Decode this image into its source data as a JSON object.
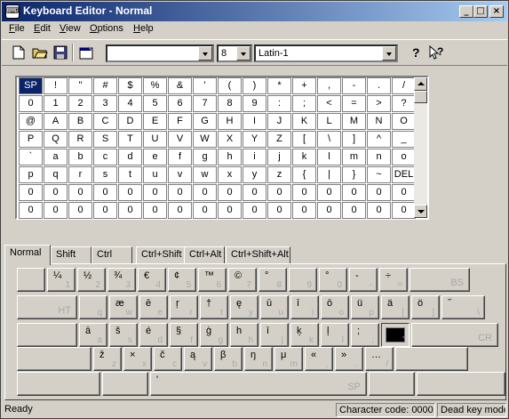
{
  "window": {
    "title": "Keyboard Editor - Normal",
    "icon_glyph": "⌨",
    "controls": {
      "minimize": "_",
      "maximize": "□",
      "close": "×"
    }
  },
  "menu": [
    {
      "label": "File",
      "ul": "F",
      "rest": "ile"
    },
    {
      "label": "Edit",
      "ul": "E",
      "rest": "dit"
    },
    {
      "label": "View",
      "ul": "V",
      "rest": "iew"
    },
    {
      "label": "Options",
      "ul": "O",
      "rest": "ptions"
    },
    {
      "label": "Help",
      "ul": "H",
      "rest": "elp"
    }
  ],
  "toolbar": {
    "icons": [
      "new-document-icon",
      "open-folder-icon",
      "save-disk-icon",
      "properties-icon",
      "help-icon",
      "context-help-icon"
    ],
    "font_name": "",
    "font_size": "8",
    "charset": "Latin-1"
  },
  "char_grid": {
    "selected": "SP",
    "rows": [
      [
        "SP",
        "!",
        "\"",
        "#",
        "$",
        "%",
        "&",
        "'",
        "(",
        ")",
        "*",
        "+",
        ",",
        "-",
        ".",
        "/"
      ],
      [
        "0",
        "1",
        "2",
        "3",
        "4",
        "5",
        "6",
        "7",
        "8",
        "9",
        ":",
        ";",
        "<",
        "=",
        ">",
        "?"
      ],
      [
        "@",
        "A",
        "B",
        "C",
        "D",
        "E",
        "F",
        "G",
        "H",
        "I",
        "J",
        "K",
        "L",
        "M",
        "N",
        "O"
      ],
      [
        "P",
        "Q",
        "R",
        "S",
        "T",
        "U",
        "V",
        "W",
        "X",
        "Y",
        "Z",
        "[",
        "\\",
        "]",
        "^",
        "_"
      ],
      [
        "`",
        "a",
        "b",
        "c",
        "d",
        "e",
        "f",
        "g",
        "h",
        "i",
        "j",
        "k",
        "l",
        "m",
        "n",
        "o"
      ],
      [
        "p",
        "q",
        "r",
        "s",
        "t",
        "u",
        "v",
        "w",
        "x",
        "y",
        "z",
        "{",
        "|",
        "}",
        "~",
        "DEL"
      ],
      [
        "0",
        "0",
        "0",
        "0",
        "0",
        "0",
        "0",
        "0",
        "0",
        "0",
        "0",
        "0",
        "0",
        "0",
        "0",
        "0"
      ],
      [
        "0",
        "0",
        "0",
        "0",
        "0",
        "0",
        "0",
        "0",
        "0",
        "0",
        "0",
        "0",
        "0",
        "0",
        "0",
        "0"
      ]
    ]
  },
  "tabs": [
    "Normal",
    "Shift",
    "Ctrl",
    "Ctrl+Shift",
    "Ctrl+Alt",
    "Ctrl+Shift+Alt"
  ],
  "active_tab": "Normal",
  "keyboard": {
    "row1": [
      {
        "top": "",
        "bot": ""
      },
      {
        "top": "¼",
        "bot": "1"
      },
      {
        "top": "½",
        "bot": "2"
      },
      {
        "top": "¾",
        "bot": "3"
      },
      {
        "top": "€",
        "bot": "4"
      },
      {
        "top": "¢",
        "bot": "5"
      },
      {
        "top": "™",
        "bot": "6"
      },
      {
        "top": "©",
        "bot": "7"
      },
      {
        "top": "°",
        "bot": "8"
      },
      {
        "top": "",
        "bot": "9"
      },
      {
        "top": "°",
        "bot": "0"
      },
      {
        "top": "-",
        "bot": "-"
      },
      {
        "top": "÷",
        "bot": "="
      },
      {
        "top": "",
        "bot": "BS"
      }
    ],
    "row2": [
      {
        "top": "",
        "bot": "HT"
      },
      {
        "top": "",
        "bot": "q"
      },
      {
        "top": "æ",
        "bot": "w"
      },
      {
        "top": "ē",
        "bot": "e"
      },
      {
        "top": "ŗ",
        "bot": "r"
      },
      {
        "top": "†",
        "bot": "t"
      },
      {
        "top": "ę",
        "bot": "y"
      },
      {
        "top": "ū",
        "bot": "u"
      },
      {
        "top": "ī",
        "bot": "i"
      },
      {
        "top": "ō",
        "bot": "o"
      },
      {
        "top": "ü",
        "bot": "p"
      },
      {
        "top": "ä",
        "bot": "["
      },
      {
        "top": "ö",
        "bot": "]"
      },
      {
        "top": "˝",
        "bot": "\\"
      }
    ],
    "row3": [
      {
        "top": "",
        "bot": ""
      },
      {
        "top": "ā",
        "bot": "a"
      },
      {
        "top": "š",
        "bot": "s"
      },
      {
        "top": "é",
        "bot": "d"
      },
      {
        "top": "§",
        "bot": "f"
      },
      {
        "top": "ģ",
        "bot": "g"
      },
      {
        "top": "h",
        "bot": "h"
      },
      {
        "top": "ī",
        "bot": "j"
      },
      {
        "top": "ķ",
        "bot": "k"
      },
      {
        "top": "ļ",
        "bot": "l"
      },
      {
        "top": ";",
        "bot": ";"
      },
      {
        "top": "",
        "bot": "'"
      },
      {
        "top": "",
        "bot": "CR"
      }
    ],
    "row4": [
      {
        "top": "",
        "bot": ""
      },
      {
        "top": "ž",
        "bot": "z"
      },
      {
        "top": "×",
        "bot": "x"
      },
      {
        "top": "č",
        "bot": "c"
      },
      {
        "top": "ą",
        "bot": "v"
      },
      {
        "top": "β",
        "bot": "b"
      },
      {
        "top": "ŋ",
        "bot": "n"
      },
      {
        "top": "μ",
        "bot": "m"
      },
      {
        "top": "«",
        "bot": ","
      },
      {
        "top": "»",
        "bot": "."
      },
      {
        "top": "…",
        "bot": "/"
      },
      {
        "top": "",
        "bot": ""
      }
    ],
    "row5": [
      {
        "top": "",
        "bot": ""
      },
      {
        "top": "",
        "bot": ""
      },
      {
        "top": "'",
        "bot": "SP"
      },
      {
        "top": "",
        "bot": ""
      },
      {
        "top": "",
        "bot": ""
      }
    ]
  },
  "status": {
    "left": "Ready",
    "char_code": "Character code: 0000",
    "mode": "Dead key mode"
  }
}
